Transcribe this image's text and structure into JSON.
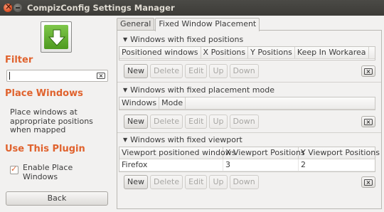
{
  "window": {
    "title": "CompizConfig Settings Manager"
  },
  "sidebar": {
    "filter_heading": "Filter",
    "filter_value": "",
    "place_windows_heading": "Place Windows",
    "description": "Place windows at appropriate positions when mapped",
    "use_plugin_heading": "Use This Plugin",
    "enable_label": "Enable Place Windows",
    "enable_checked": true,
    "back_label": "Back"
  },
  "tabs": [
    "General",
    "Fixed Window Placement"
  ],
  "active_tab": 1,
  "groups": {
    "fixed_positions": {
      "title": "Windows with fixed positions",
      "columns": [
        "Positioned windows",
        "X Positions",
        "Y Positions",
        "Keep In Workarea"
      ]
    },
    "fixed_mode": {
      "title": "Windows with fixed placement mode",
      "columns": [
        "Windows",
        "Mode"
      ]
    },
    "fixed_viewport": {
      "title": "Windows with fixed viewport",
      "columns": [
        "Viewport positioned windows",
        "X Viewport Positions",
        "Y Viewport Positions"
      ],
      "rows": [
        {
          "window": "Firefox",
          "x": "3",
          "y": "2"
        }
      ]
    }
  },
  "buttons": {
    "new": "New",
    "delete": "Delete",
    "edit": "Edit",
    "up": "Up",
    "down": "Down"
  },
  "icons": {
    "plugin": "download-arrow-icon",
    "clear": "clear-icon",
    "close": "close-icon",
    "minimize": "minimize-icon"
  }
}
